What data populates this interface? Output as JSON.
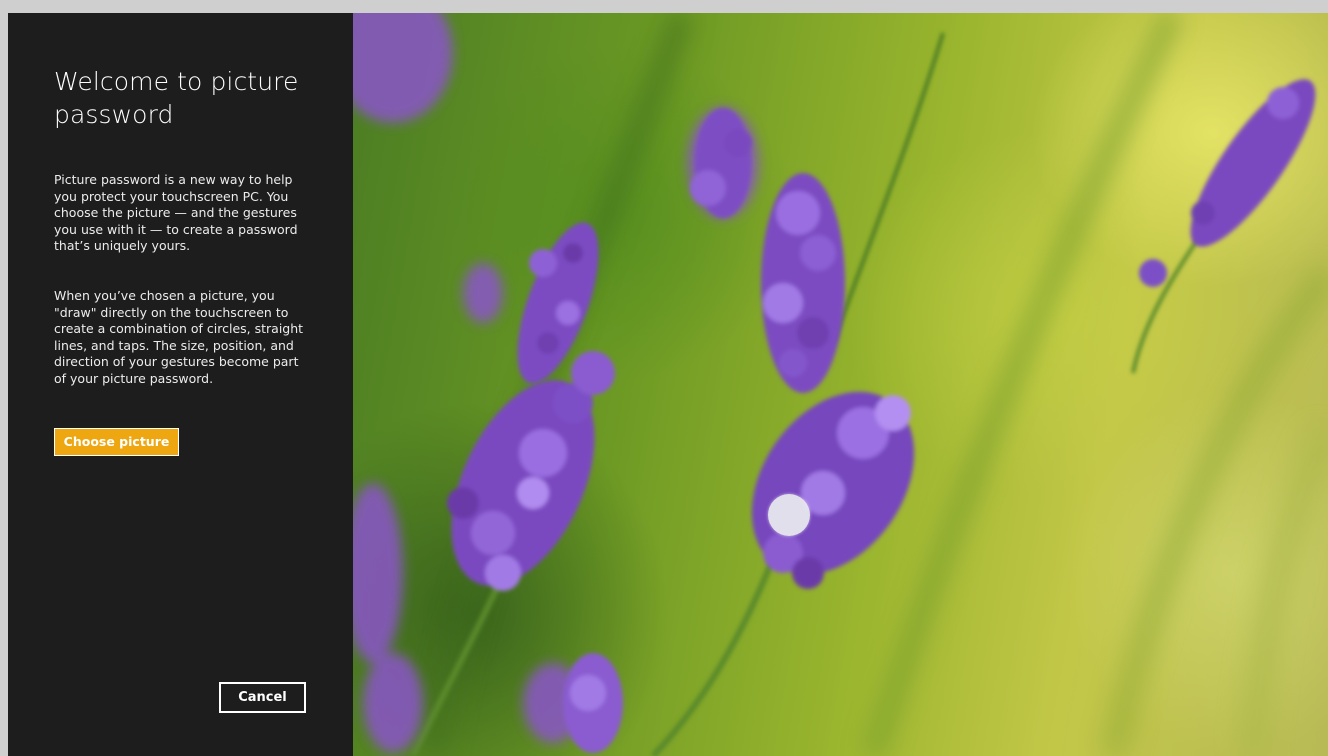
{
  "welcome": {
    "title": "Welcome to picture password",
    "paragraph_1": "Picture password is a new way to help you protect your touchscreen PC. You choose the picture — and the gestures you use with it — to create a password that’s uniquely yours.",
    "paragraph_2": "When you’ve chosen a picture, you \"draw\" directly on the touchscreen to create a combination of circles, straight lines, and taps. The size, position, and direction of your gestures become part of your picture password."
  },
  "buttons": {
    "choose_picture": "Choose picture",
    "cancel": "Cancel"
  },
  "colors": {
    "panel_background": "#1d1d1d",
    "accent": "#eea711",
    "text": "#ffffff"
  },
  "image": {
    "subject": "lavender-flowers-photo"
  }
}
